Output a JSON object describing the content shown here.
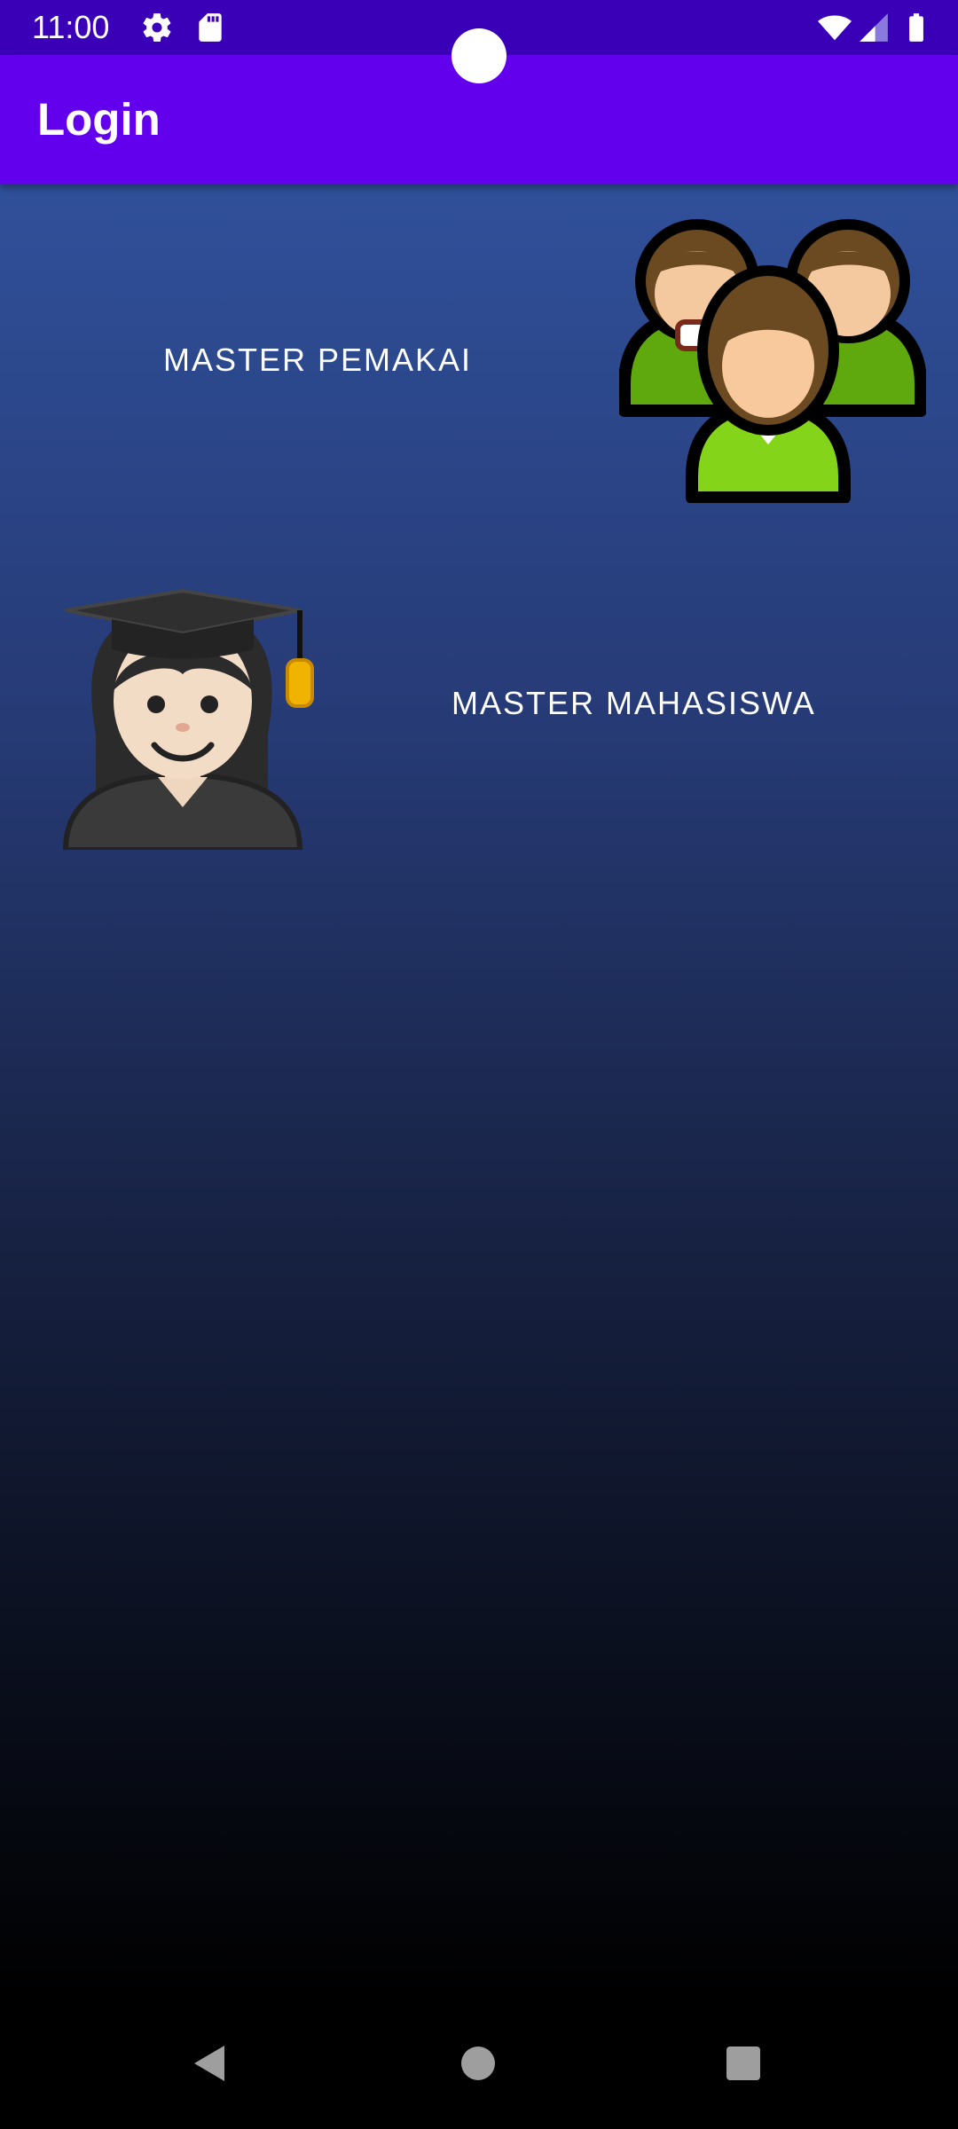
{
  "status_bar": {
    "time": "11:00",
    "icons": [
      "settings-icon",
      "sd-card-icon",
      "wifi-icon",
      "signal-icon",
      "battery-icon"
    ]
  },
  "app_bar": {
    "title": "Login"
  },
  "menu": {
    "items": [
      {
        "label": "MASTER PEMAKAI",
        "icon": "users-group-icon"
      },
      {
        "label": "MASTER MAHASISWA",
        "icon": "student-graduate-icon"
      }
    ]
  },
  "nav_bar": {
    "buttons": [
      "back-icon",
      "home-icon",
      "recents-icon"
    ]
  },
  "colors": {
    "status_bar": "#3a00b8",
    "app_bar": "#6200ee",
    "gradient_top": "#30509a",
    "gradient_bottom": "#000000"
  }
}
